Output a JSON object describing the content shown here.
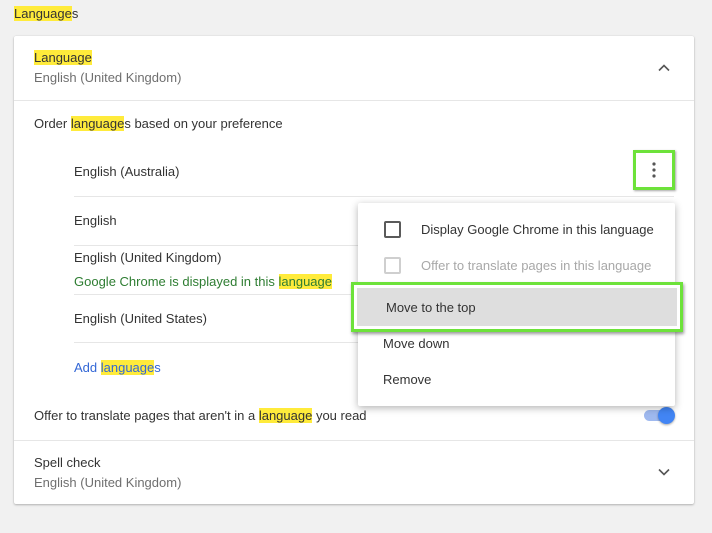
{
  "section": {
    "title_hl": "Language",
    "title_rest": "s"
  },
  "language_row": {
    "title": "Language",
    "subtitle": "English (United Kingdom)"
  },
  "order_label": {
    "prefix": "Order ",
    "hl": "language",
    "suffix": "s based on your preference"
  },
  "languages": [
    {
      "name": "English (Australia)"
    },
    {
      "name": "English"
    },
    {
      "name": "English (United Kingdom)",
      "note_prefix": "Google Chrome is displayed in this ",
      "note_hl": "language"
    },
    {
      "name": "English (United States)"
    }
  ],
  "add_link": {
    "prefix": "Add ",
    "hl": "language",
    "suffix": "s"
  },
  "translate_row": {
    "prefix": "Offer to translate pages that aren't in a ",
    "hl": "language",
    "suffix": " you read",
    "toggle_on": true
  },
  "spell_check": {
    "title": "Spell check",
    "subtitle": "English (United Kingdom)"
  },
  "menu": {
    "display_in_language": "Display Google Chrome in this language",
    "offer_translate": "Offer to translate pages in this language",
    "move_top": "Move to the top",
    "move_down": "Move down",
    "remove": "Remove"
  },
  "colors": {
    "highlight": "#ffeb3b",
    "accent_green_box": "#6de23a",
    "link_blue": "#3367d6",
    "note_green": "#2e7d32",
    "toggle_blue": "#4285f4"
  },
  "icons": {
    "expand": "chevron-up-icon",
    "collapse": "chevron-down-icon",
    "more": "more-vert-icon"
  }
}
